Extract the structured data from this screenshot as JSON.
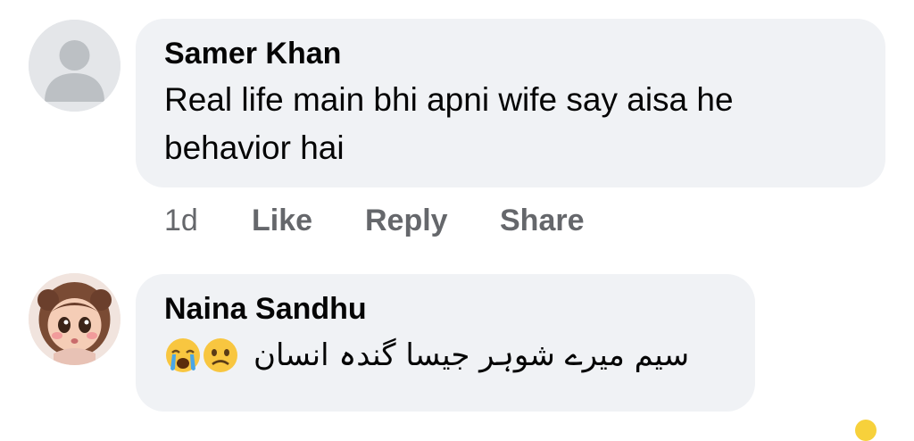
{
  "comments": [
    {
      "author": "Samer Khan",
      "text": "Real life main bhi apni wife say aisa he behavior hai",
      "avatar_icon": "default-profile-icon",
      "actions": {
        "time": "1d",
        "like": "Like",
        "reply": "Reply",
        "share": "Share"
      }
    },
    {
      "author": "Naina Sandhu",
      "text": "سیم میرے شوہر جیسا گندہ انسان",
      "emojis": [
        "loudly-crying-face-icon",
        "sad-face-icon"
      ],
      "avatar_icon": "cartoon-girl-avatar-icon"
    }
  ],
  "colors": {
    "bubble": "#f0f2f5",
    "action_text": "#65676b",
    "text": "#050505"
  }
}
